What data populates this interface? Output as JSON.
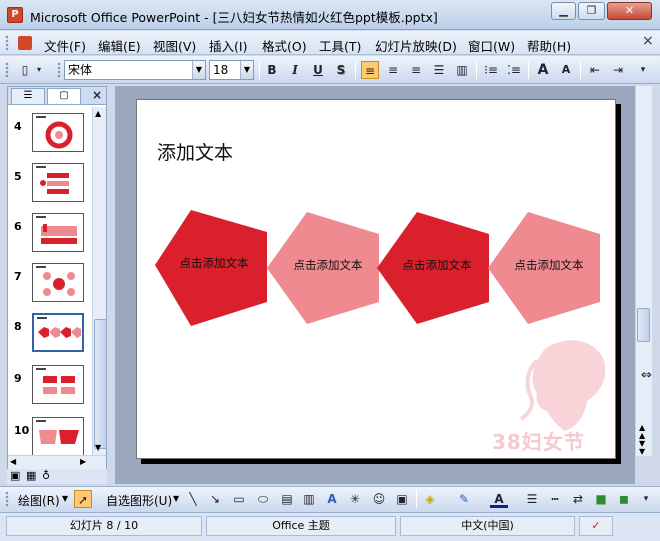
{
  "window": {
    "title": "Microsoft Office PowerPoint - [三八妇女节热情如火红色ppt模板.pptx]",
    "app_icon_letter": "P"
  },
  "menu": {
    "items": [
      "文件(F)",
      "编辑(E)",
      "视图(V)",
      "插入(I)",
      "格式(O)",
      "工具(T)",
      "幻灯片放映(D)",
      "窗口(W)",
      "帮助(H)"
    ],
    "close_glyph": "×"
  },
  "toolbar": {
    "font_name": "宋体",
    "font_size": "18",
    "bold": "B",
    "italic": "I",
    "underline": "U",
    "shadow": "S",
    "grow_font": "A",
    "shrink_font": "A"
  },
  "slides_pane": {
    "thumbnails": [
      {
        "num": "4"
      },
      {
        "num": "5"
      },
      {
        "num": "6"
      },
      {
        "num": "7"
      },
      {
        "num": "8",
        "selected": true
      },
      {
        "num": "9"
      },
      {
        "num": "10"
      }
    ]
  },
  "slide": {
    "title": "添加文本",
    "shapes": [
      {
        "label": "点击添加文本",
        "color": "#d9202c"
      },
      {
        "label": "点击添加文本",
        "color": "#ef8a91"
      },
      {
        "label": "点击添加文本",
        "color": "#d9202c"
      },
      {
        "label": "点击添加文本",
        "color": "#ef8a91"
      }
    ],
    "watermark": "38妇女节"
  },
  "drawing": {
    "draw_label": "绘图(R)",
    "autoshapes_label": "自选图形(U)"
  },
  "status": {
    "slide_pos": "幻灯片 8 / 10",
    "theme": "Office 主题",
    "language": "中文(中国)"
  },
  "colors": {
    "accent_red": "#d9202c",
    "accent_pink": "#ef8a91",
    "chrome_blue": "#cfd9ea"
  }
}
